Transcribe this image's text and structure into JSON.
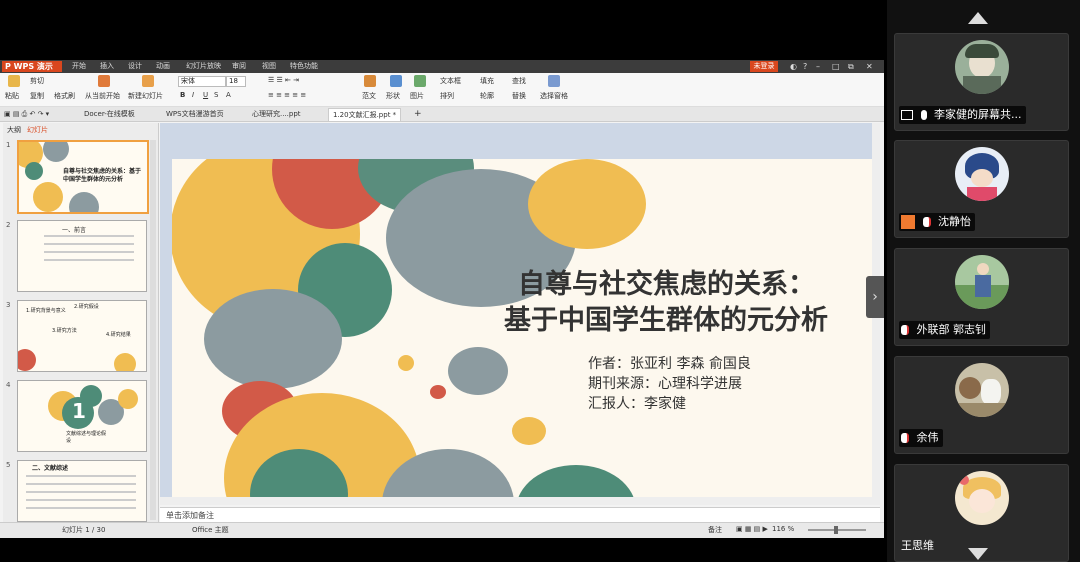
{
  "window": {
    "app_logo": "P WPS 演示",
    "menu": [
      "开始",
      "插入",
      "设计",
      "动画",
      "幻灯片放映",
      "审阅",
      "视图",
      "特色功能"
    ],
    "login_label": "未登录"
  },
  "ribbon": {
    "paste": "粘贴",
    "cut": "剪切",
    "copy": "复制",
    "format_painter": "格式刷",
    "from_current": "从当前开始",
    "new_slide": "新建幻灯片",
    "font_name": "宋体",
    "font_size": "18",
    "template": "范文",
    "shape": "形状",
    "picture": "图片",
    "textbox": "文本框",
    "arrange": "排列",
    "replace": "替换",
    "find": "查找",
    "select_pane": "选择窗格",
    "fill": "填充",
    "outline": "轮廓"
  },
  "tabs": [
    {
      "label": "Docer-在线模板",
      "active": false
    },
    {
      "label": "WPS文档漫游首页",
      "active": false
    },
    {
      "label": "心理研究....ppt",
      "active": false
    },
    {
      "label": "1.20文献汇报.ppt *",
      "active": true
    }
  ],
  "left_panel": {
    "tab_outline": "大纲",
    "tab_slides": "幻灯片",
    "thumb1_title": "自尊与社交焦虑的关系：基于中国学生群体的元分析",
    "thumb2_title": "一、前言",
    "thumb3_labels": [
      "1.研究背景与意义",
      "2.研究假设",
      "3.研究方法",
      "4.研究结果"
    ],
    "thumb4_number": "1",
    "thumb4_label": "文献综述与理论假设",
    "thumb5_title": "二、文献综述"
  },
  "slide": {
    "title_line1": "自尊与社交焦虑的关系：",
    "title_line2": "基于中国学生群体的元分析",
    "author": "作者：张亚利  李森  俞国良",
    "journal": "期刊来源：心理科学进展",
    "presenter": "汇报人：李家健"
  },
  "notes_placeholder": "单击添加备注",
  "status": {
    "slide_counter": "幻灯片 1 / 30",
    "theme": "Office 主题",
    "notes_btn": "备注",
    "zoom": "116 %"
  },
  "participants": [
    {
      "name": "李家健的屏幕共...",
      "sharing": true
    },
    {
      "name": "沈静怡",
      "sharing": false
    },
    {
      "name": "外联部 郭志钊",
      "sharing": false
    },
    {
      "name": "余伟",
      "sharing": false
    },
    {
      "name": "王思维",
      "sharing": false
    }
  ],
  "colors": {
    "yellow": "#f0bd52",
    "red": "#d25a48",
    "teal": "#4e8c78",
    "gray": "#8c9ba0",
    "wps_orange": "#d9471e"
  }
}
